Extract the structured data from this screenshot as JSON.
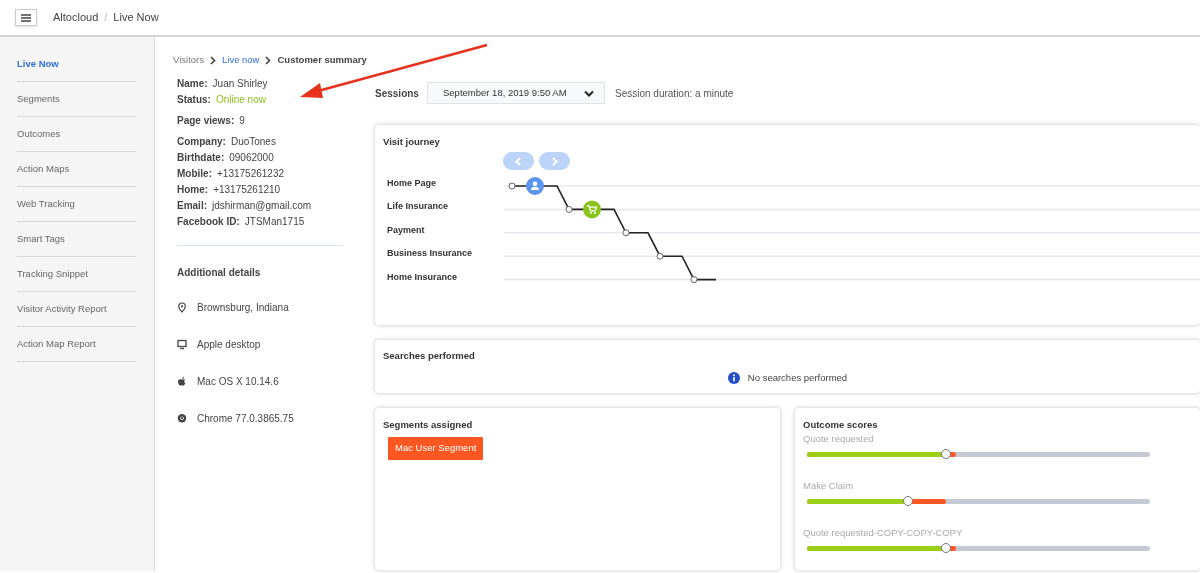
{
  "header": {
    "breadcrumb": [
      "Altocloud",
      "/",
      "Live Now"
    ]
  },
  "sidebar": {
    "items": [
      {
        "label": "Live Now",
        "selected": true
      },
      {
        "label": "Segments",
        "selected": false
      },
      {
        "label": "Outcomes",
        "selected": false
      },
      {
        "label": "Action Maps",
        "selected": false
      },
      {
        "label": "Web Tracking",
        "selected": false
      },
      {
        "label": "Smart Tags",
        "selected": false
      },
      {
        "label": "Tracking Snippet",
        "selected": false
      },
      {
        "label": "Visitor Activity Report",
        "selected": false
      },
      {
        "label": "Action Map Report",
        "selected": false
      }
    ]
  },
  "breadcrumb": [
    {
      "label": "Visitors",
      "kind": "plain"
    },
    {
      "label": "Live now",
      "kind": "link"
    },
    {
      "label": "Customer summary",
      "kind": "current"
    }
  ],
  "field_groups": [
    [
      {
        "label": "Name:",
        "value": "Juan Shirley",
        "kind": "plain"
      },
      {
        "label": "Status:",
        "value": "Online now",
        "kind": "status"
      }
    ],
    [
      {
        "label": "Page views:",
        "value": "9",
        "kind": "plain"
      }
    ],
    [
      {
        "label": "Company:",
        "value": "DuoTones",
        "kind": "plain"
      },
      {
        "label": "Birthdate:",
        "value": "09062000",
        "kind": "plain"
      },
      {
        "label": "Mobile:",
        "value": "+13175261232",
        "kind": "plain"
      },
      {
        "label": "Home:",
        "value": "+13175261210",
        "kind": "plain"
      },
      {
        "label": "Email:",
        "value": "jdshirman@gmail.com",
        "kind": "plain"
      },
      {
        "label": "Facebook ID:",
        "value": "JTSMan1715",
        "kind": "plain"
      }
    ]
  ],
  "additional_details": {
    "title": "Additional details",
    "items": [
      {
        "kind": "location",
        "text": "Brownsburg, Indiana"
      },
      {
        "kind": "device",
        "text": "Apple desktop"
      },
      {
        "kind": "os",
        "text": "Mac OS X 10.14.6"
      },
      {
        "kind": "browser",
        "text": "Chrome 77.0.3865.75"
      }
    ]
  },
  "sessions": {
    "label": "Sessions",
    "value": "September 18, 2019 9:50 AM",
    "duration": "Session duration: a minute"
  },
  "visit_journey": {
    "title": "Visit journey",
    "pages": [
      {
        "label": "Home Page",
        "kind": "visitor"
      },
      {
        "label": "Life Insurance",
        "kind": "cart"
      },
      {
        "label": "Payment",
        "kind": "plain"
      },
      {
        "label": "Business Insurance",
        "kind": "plain"
      },
      {
        "label": "Home Insurance",
        "kind": "plain"
      }
    ]
  },
  "searches": {
    "title": "Searches performed",
    "message": "No searches performed"
  },
  "segments": {
    "title": "Segments assigned",
    "tags": [
      "Mac User Segment"
    ]
  },
  "outcome_scores": {
    "title": "Outcome scores",
    "items": [
      {
        "label": "Quote requested",
        "level": 0.405,
        "average": {
          "level": 0.434
        }
      },
      {
        "label": "Make Claim",
        "level": 0.295,
        "average": {
          "level": 0.405
        }
      },
      {
        "label": "Quote requested-COPY-COPY-COPY",
        "level": 0.405,
        "average": {
          "level": 0.434
        }
      }
    ]
  }
}
